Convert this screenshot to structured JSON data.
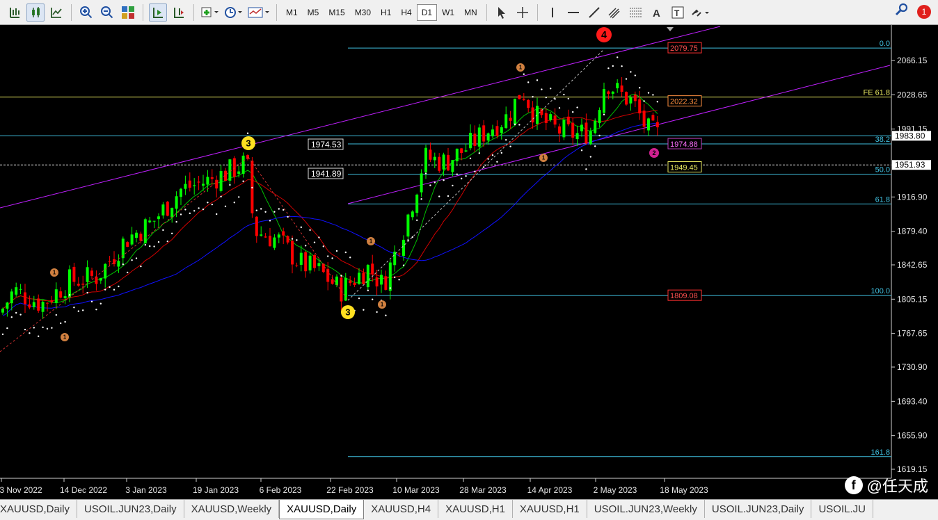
{
  "toolbar": {
    "timeframes": [
      "M1",
      "M5",
      "M15",
      "M30",
      "H1",
      "H4",
      "D1",
      "W1",
      "MN"
    ],
    "active_timeframe": "D1",
    "notification_count": "1"
  },
  "chart": {
    "price_axis": [
      "2066.15",
      "2028.65",
      "1991.15",
      "1916.90",
      "1879.40",
      "1842.65",
      "1805.15",
      "1767.65",
      "1730.90",
      "1693.40",
      "1655.90",
      "1619.15"
    ],
    "date_axis": [
      "3 Nov 2022",
      "14 Dec 2022",
      "3 Jan 2023",
      "19 Jan 2023",
      "6 Feb 2023",
      "22 Feb 2023",
      "10 Mar 2023",
      "28 Mar 2023",
      "14 Apr 2023",
      "2 May 2023",
      "18 May 2023"
    ],
    "current_price": "1983.80",
    "crosshair_price": "1951.93",
    "fib_levels": [
      "0.0",
      "FE 61.8",
      "38.2",
      "50.0",
      "61.8",
      "100.0",
      "161.8"
    ],
    "fib_tag_fe": "61.8",
    "price_tags": {
      "top": "2079.75",
      "upper": "2022.32",
      "mid": "1974.88",
      "yellow": "1949.45",
      "bottom": "1809.08",
      "left_a": "1974.53",
      "left_b": "1941.89"
    },
    "wave_labels": {
      "w4": "4",
      "w3a": "3",
      "w3b": "3",
      "w2": "2",
      "sub": "1"
    }
  },
  "tabs": [
    "XAUUSD,Daily",
    "USOIL.JUN23,Daily",
    "XAUUSD,Weekly",
    "XAUUSD,Daily",
    "XAUUSD,H4",
    "XAUUSD,H1",
    "XAUUSD,H1",
    "USOIL.JUN23,Weekly",
    "USOIL.JUN23,Daily",
    "USOIL.JU"
  ],
  "active_tab_index": 3,
  "watermark": "@任天成",
  "colors": {
    "bull": "#00ff00",
    "bear": "#ff0000",
    "ma_green": "#00c000",
    "ma_red": "#d00000",
    "ma_blue": "#1010ff",
    "channel": "#c020ff",
    "fib": "#40c0e0"
  }
}
